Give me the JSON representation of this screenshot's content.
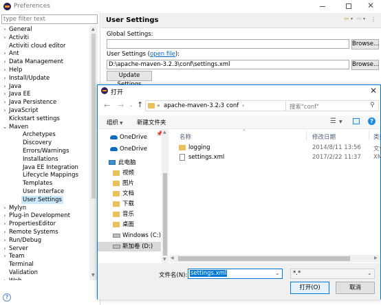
{
  "prefs": {
    "title": "Preferences",
    "filter_placeholder": "type filter text",
    "tree": [
      {
        "label": "General",
        "arrow": "›",
        "level": 0
      },
      {
        "label": "Activiti",
        "arrow": "›",
        "level": 0
      },
      {
        "label": "Activiti cloud editor",
        "arrow": "",
        "level": 0
      },
      {
        "label": "Ant",
        "arrow": "›",
        "level": 0
      },
      {
        "label": "Data Management",
        "arrow": "›",
        "level": 0
      },
      {
        "label": "Help",
        "arrow": "›",
        "level": 0
      },
      {
        "label": "Install/Update",
        "arrow": "›",
        "level": 0
      },
      {
        "label": "Java",
        "arrow": "›",
        "level": 0
      },
      {
        "label": "Java EE",
        "arrow": "›",
        "level": 0
      },
      {
        "label": "Java Persistence",
        "arrow": "›",
        "level": 0
      },
      {
        "label": "JavaScript",
        "arrow": "›",
        "level": 0
      },
      {
        "label": "Kickstart settings",
        "arrow": "",
        "level": 0
      },
      {
        "label": "Maven",
        "arrow": "⌄",
        "level": 0
      },
      {
        "label": "Archetypes",
        "arrow": "",
        "level": 1
      },
      {
        "label": "Discovery",
        "arrow": "",
        "level": 1
      },
      {
        "label": "Errors/Warnings",
        "arrow": "",
        "level": 1
      },
      {
        "label": "Installations",
        "arrow": "",
        "level": 1
      },
      {
        "label": "Java EE Integration",
        "arrow": "",
        "level": 1
      },
      {
        "label": "Lifecycle Mappings",
        "arrow": "",
        "level": 1
      },
      {
        "label": "Templates",
        "arrow": "",
        "level": 1
      },
      {
        "label": "User Interface",
        "arrow": "",
        "level": 1
      },
      {
        "label": "User Settings",
        "arrow": "",
        "level": 1,
        "selected": true
      },
      {
        "label": "Mylyn",
        "arrow": "›",
        "level": 0
      },
      {
        "label": "Plug-in Development",
        "arrow": "›",
        "level": 0
      },
      {
        "label": "PropertiesEditor",
        "arrow": "›",
        "level": 0
      },
      {
        "label": "Remote Systems",
        "arrow": "›",
        "level": 0
      },
      {
        "label": "Run/Debug",
        "arrow": "›",
        "level": 0
      },
      {
        "label": "Server",
        "arrow": "›",
        "level": 0
      },
      {
        "label": "Team",
        "arrow": "›",
        "level": 0
      },
      {
        "label": "Terminal",
        "arrow": "",
        "level": 0
      },
      {
        "label": "Validation",
        "arrow": "",
        "level": 0
      },
      {
        "label": "Web",
        "arrow": "›",
        "level": 0
      }
    ],
    "page_title": "User Settings",
    "global_settings_label": "Global Settings:",
    "global_settings_value": "",
    "user_settings_label": "User Settings (",
    "open_file_link": "open file",
    "user_settings_label_end": "):",
    "user_settings_value": "D:\\apache-maven-3.2.3\\conf\\settings.xml",
    "browse_label": "Browse...",
    "update_settings_label": "Update Settings"
  },
  "dialog": {
    "title": "打开",
    "breadcrumb": [
      "apache-maven-3.2.3",
      "conf"
    ],
    "search_placeholder": "搜索\"conf\"",
    "organize_label": "组织",
    "new_folder_label": "新建文件夹",
    "columns": {
      "name": "名称",
      "date": "修改日期",
      "type": "类型"
    },
    "nav": [
      {
        "label": "OneDrive",
        "icon": "cloud-icon"
      },
      {
        "label": "OneDrive",
        "icon": "cloud-icon"
      },
      {
        "label": "此电脑",
        "icon": "computer-icon"
      },
      {
        "label": "视频",
        "icon": "folder-icon"
      },
      {
        "label": "图片",
        "icon": "folder-icon"
      },
      {
        "label": "文档",
        "icon": "folder-icon"
      },
      {
        "label": "下载",
        "icon": "folder-icon"
      },
      {
        "label": "音乐",
        "icon": "folder-icon"
      },
      {
        "label": "桌面",
        "icon": "folder-icon"
      },
      {
        "label": "Windows (C:)",
        "icon": "drive-icon"
      },
      {
        "label": "新加卷 (D:)",
        "icon": "drive-icon"
      }
    ],
    "files": [
      {
        "name": "logging",
        "date": "2014/8/11 13:56",
        "type": "文件",
        "kind": "folder"
      },
      {
        "name": "settings.xml",
        "date": "2017/2/22 11:37",
        "type": "XM",
        "kind": "file"
      }
    ],
    "filename_label": "文件名(N):",
    "filename_value": "settings.xml",
    "filetype_value": "*.*",
    "open_label": "打开(O)",
    "cancel_label": "取消"
  },
  "colors": {
    "selection": "#cce8ff",
    "accent": "#0078d7",
    "link": "#0066cc"
  }
}
